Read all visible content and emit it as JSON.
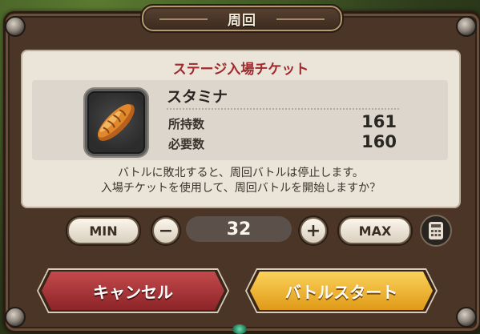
{
  "dialog": {
    "title": "周回"
  },
  "ticket": {
    "header": "ステージ入場チケット",
    "item_name": "スタミナ",
    "item_icon": "bread-icon",
    "owned_label": "所持数",
    "owned_value": "161",
    "required_label": "必要数",
    "required_value": "160"
  },
  "message": {
    "line1": "バトルに敗北すると、周回バトルは停止します。",
    "line2": "入場チケットを使用して、周回バトルを開始しますか？"
  },
  "counter": {
    "min_label": "MIN",
    "minus_symbol": "−",
    "value": "32",
    "plus_symbol": "+",
    "max_label": "MAX",
    "calc_icon": "calculator-icon"
  },
  "actions": {
    "cancel_label": "キャンセル",
    "start_label": "バトルスタート"
  },
  "colors": {
    "accent_red": "#a02a2e",
    "cancel": "#a8363a",
    "start": "#f0b430",
    "frame": "#4a3527"
  }
}
